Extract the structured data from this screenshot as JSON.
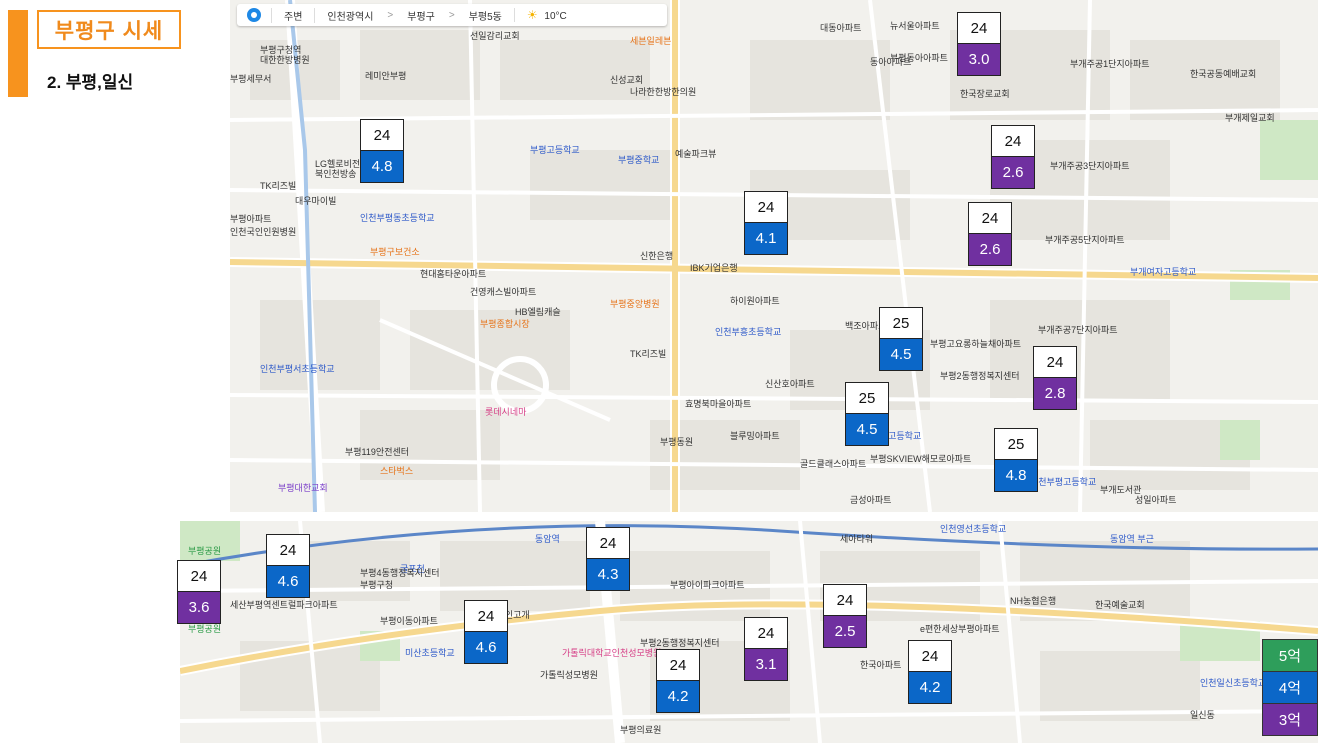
{
  "header": {
    "title": "부평구 시세",
    "subtitle": "2. 부평,일신"
  },
  "colors": {
    "accent": "#f7931e",
    "price_5": "#2e9e5b",
    "price_4": "#0b67c8",
    "price_3": "#7030a0"
  },
  "map_bar": {
    "nearby": "주변",
    "city": "인천광역시",
    "district": "부평구",
    "dong": "부평5동",
    "weather_icon": "sun-icon",
    "temperature": "10°C"
  },
  "top_markers": [
    {
      "year": "24",
      "price": "3.0",
      "tier": "purple"
    },
    {
      "year": "24",
      "price": "4.8",
      "tier": "blue"
    },
    {
      "year": "24",
      "price": "2.6",
      "tier": "purple"
    },
    {
      "year": "24",
      "price": "4.1",
      "tier": "blue"
    },
    {
      "year": "24",
      "price": "2.6",
      "tier": "purple"
    },
    {
      "year": "25",
      "price": "4.5",
      "tier": "blue"
    },
    {
      "year": "24",
      "price": "2.8",
      "tier": "purple"
    },
    {
      "year": "25",
      "price": "4.5",
      "tier": "blue"
    },
    {
      "year": "25",
      "price": "4.8",
      "tier": "blue"
    }
  ],
  "bottom_markers": [
    {
      "year": "24",
      "price": "3.6",
      "tier": "purple"
    },
    {
      "year": "24",
      "price": "4.6",
      "tier": "blue"
    },
    {
      "year": "24",
      "price": "4.3",
      "tier": "blue"
    },
    {
      "year": "24",
      "price": "4.6",
      "tier": "blue"
    },
    {
      "year": "24",
      "price": "4.2",
      "tier": "blue"
    },
    {
      "year": "24",
      "price": "3.1",
      "tier": "purple"
    },
    {
      "year": "24",
      "price": "2.5",
      "tier": "purple"
    },
    {
      "year": "24",
      "price": "4.2",
      "tier": "blue"
    }
  ],
  "legend": [
    {
      "label": "5억",
      "color": "#2e9e5b"
    },
    {
      "label": "4억",
      "color": "#0b67c8"
    },
    {
      "label": "3억",
      "color": "#7030a0"
    }
  ],
  "top_map_labels": [
    "부평구청역",
    "대한한방병원",
    "부평세무서",
    "레미안부평",
    "LG헬로비전",
    "북인천방송",
    "TK리즈빌",
    "대우마이빌",
    "부평아파트",
    "인천부평동초등학교",
    "인천국인인원병원",
    "선일감리교회",
    "세븐일레븐",
    "신성교회",
    "나라한한방한의원",
    "부평고등학교",
    "부평중학교",
    "예술파크뷰",
    "부평동아아파트",
    "동아아파트",
    "부평구보건소",
    "현대홈타운아파트",
    "건영캐스빌아파트",
    "부평종합시장",
    "HB엘림캐슬",
    "부평중앙병원",
    "신한은행",
    "IBK기업은행",
    "하이원아파트",
    "백조아파트",
    "부평고요롱하늘채아파트",
    "한국장로교회",
    "부개주공1단지아파트",
    "부개주공3단지아파트",
    "부개주공5단지아파트",
    "부개여자고등학교",
    "부개주공7단지아파트",
    "부평2동행정복지센터",
    "인천부흥초등학교",
    "TK리즈빌",
    "인천부평서초등학교",
    "롯데시네마",
    "부평119안전센터",
    "스타벅스",
    "부평대한교회",
    "신산호아파트",
    "효명북마을아파트",
    "블루밍아파트",
    "부평동원",
    "골드클래스아파트",
    "부평SKVIEW해모로아파트",
    "금성아파트",
    "인천부평고등학교",
    "부개도서관",
    "성일아파트",
    "부평여자고등학교",
    "부개제일교회",
    "대동아파트",
    "뉴서울아파트",
    "한국공동예배교회"
  ],
  "bottom_map_labels": [
    "부평공원",
    "세산부평역센트럴파크아파트",
    "부평구청",
    "부평공원",
    "굴포천",
    "부평4동행정복지센터",
    "미산초등학교",
    "가톨릭대학교인천성모병원",
    "부평2동행정복지센터",
    "한국아파트",
    "부평아이파크아파트",
    "동암역",
    "NH농협은행",
    "가톨릭성모병원",
    "e편한세상부평아파트",
    "인천영선초등학교",
    "세아타워",
    "한국예술교회",
    "인천일신초등학교",
    "일신동",
    "북서네인고개",
    "부평이동아파트",
    "동암역 부근",
    "부평의료원"
  ]
}
